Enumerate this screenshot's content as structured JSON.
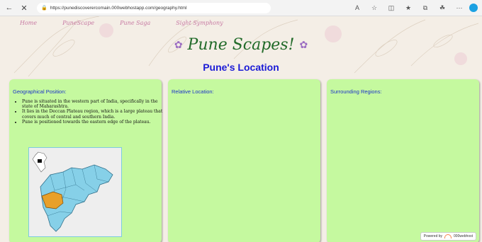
{
  "browser": {
    "url": "https://punediscoverercomain.000webhostapp.com/geography.html"
  },
  "nav": {
    "items": [
      {
        "label": "Home"
      },
      {
        "label": "PuneScape"
      },
      {
        "label": "Pune Saga"
      },
      {
        "label": "Sight Symphony"
      }
    ]
  },
  "header": {
    "title": "Pune Scapes!",
    "subtitle": "Pune's Location"
  },
  "cards": [
    {
      "heading": "Geographical Position:",
      "bullets": [
        "Pune is situated in the western part of India, specifically in the state of Maharashtra.",
        "It lies in the Deccan Plateau region, which is a large plateau that covers much of central and southern India.",
        "Pune is positioned towards the eastern edge of the plateau."
      ]
    },
    {
      "heading": "Relative Location:"
    },
    {
      "heading": "Surrounding Regions:"
    }
  ],
  "badge": {
    "prefix": "Powered by",
    "brand": "000webhost"
  },
  "colors": {
    "card_bg": "#c5f99f",
    "heading_blue": "#1b32c9",
    "title_green": "#226b2a",
    "nav_pink": "#c77aa3"
  }
}
